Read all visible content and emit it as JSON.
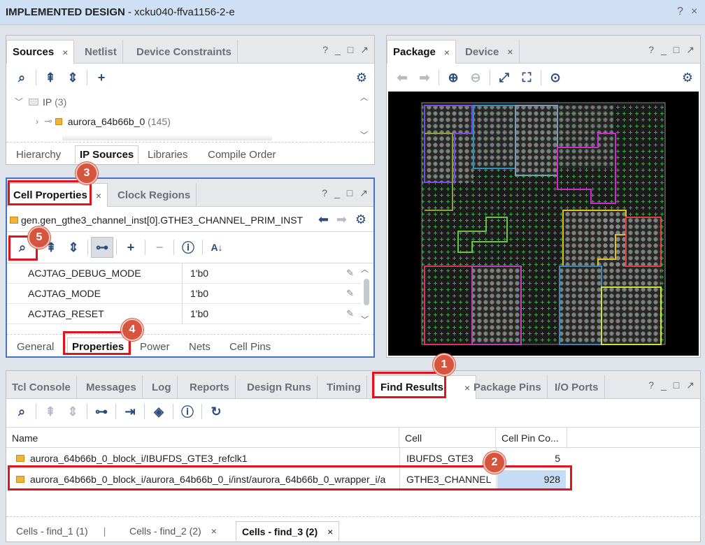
{
  "title": {
    "main": "IMPLEMENTED DESIGN",
    "part": "- xcku040-ffva1156-2-e"
  },
  "sources": {
    "tabs": [
      "Sources",
      "Netlist",
      "Device Constraints"
    ],
    "tree": [
      {
        "label": "IP",
        "count": "(3)"
      },
      {
        "label": "aurora_64b66b_0",
        "count": "(145)"
      }
    ],
    "bottom_tabs": [
      "Hierarchy",
      "IP Sources",
      "Libraries",
      "Compile Order"
    ]
  },
  "cell_properties": {
    "tabs": [
      "Cell Properties",
      "Clock Regions"
    ],
    "path": "gen.gen_gthe3_channel_inst[0].GTHE3_CHANNEL_PRIM_INST",
    "rows": [
      {
        "key": "ACJTAG_DEBUG_MODE",
        "value": "1'b0"
      },
      {
        "key": "ACJTAG_MODE",
        "value": "1'b0"
      },
      {
        "key": "ACJTAG_RESET",
        "value": "1'b0"
      }
    ],
    "bottom_tabs": [
      "General",
      "Properties",
      "Power",
      "Nets",
      "Cell Pins"
    ]
  },
  "package": {
    "tabs": [
      "Package",
      "Device"
    ]
  },
  "find": {
    "tabs": [
      "Tcl Console",
      "Messages",
      "Log",
      "Reports",
      "Design Runs",
      "Timing",
      "Find Results",
      "Package Pins",
      "I/O Ports"
    ],
    "columns": [
      "Name",
      "Cell",
      "Cell Pin Co..."
    ],
    "rows": [
      {
        "name": "aurora_64b66b_0_block_i/IBUFDS_GTE3_refclk1",
        "cell": "IBUFDS_GTE3",
        "pins": "5"
      },
      {
        "name": "aurora_64b66b_0_block_i/aurora_64b66b_0_i/inst/aurora_64b66b_0_wrapper_i/a",
        "cell": "GTHE3_CHANNEL",
        "pins": "928"
      }
    ],
    "bottom_tabs": [
      "Cells - find_1 (1)",
      "Cells - find_2 (2)",
      "Cells - find_3 (2)"
    ]
  },
  "callouts": [
    "1",
    "2",
    "3",
    "4",
    "5"
  ],
  "icons": {
    "help": "?",
    "minimize": "_",
    "maximize": "□",
    "float": "↗",
    "close": "×"
  }
}
